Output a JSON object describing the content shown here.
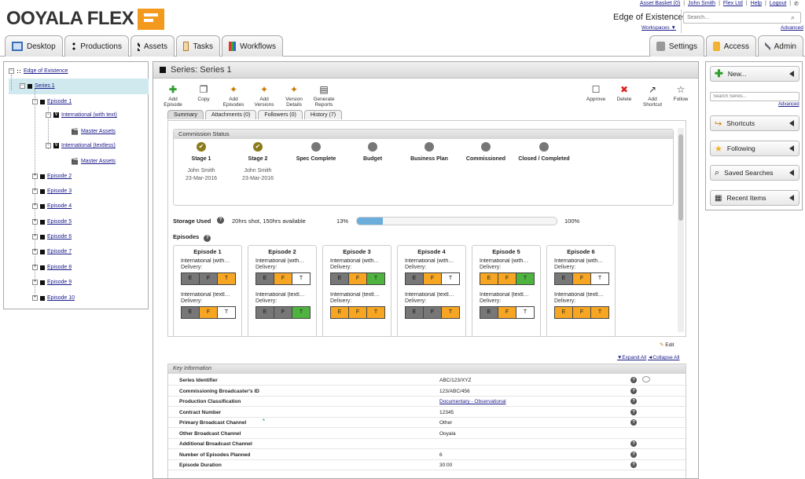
{
  "logo": "OOYALA FLEX",
  "toplinks": [
    "Asset Basket (0)",
    "John Smith",
    "Flex Ltd",
    "Help",
    "Logout"
  ],
  "workspace": {
    "title": "Edge of Existence",
    "link": "Workspaces ▼"
  },
  "search": {
    "placeholder": "Search...",
    "advanced": "Advanced"
  },
  "tabs": [
    "Desktop",
    "Productions",
    "Assets",
    "Tasks",
    "Workflows"
  ],
  "tabs_right": [
    "Settings",
    "Access",
    "Admin"
  ],
  "tree": {
    "root": "Edge of Existence",
    "series": "Series 1",
    "episode1": "Episode 1",
    "intl_text": "International (with text)",
    "master1": "Master Assets",
    "intl_textless": "International (textless)",
    "master2": "Master Assets",
    "episodes": [
      "Episode 2",
      "Episode 3",
      "Episode 4",
      "Episode 5",
      "Episode 6",
      "Episode 7",
      "Episode 8",
      "Episode 9",
      "Episode 10"
    ]
  },
  "main": {
    "title": "Series: Series 1",
    "toolbar": [
      "Add Episode",
      "Copy",
      "Add Episodes",
      "Add Versions",
      "Version Details",
      "Generate Reports"
    ],
    "toolbar_right": [
      "Approve",
      "Delete",
      "Add Shortcut",
      "Follow"
    ],
    "subtabs": [
      "Summary",
      "Attachments (0)",
      "Followers (0)",
      "History (7)"
    ]
  },
  "commission": {
    "header": "Commission Status",
    "stages": [
      {
        "name": "Stage 1",
        "done": true,
        "who": "John Smith",
        "date": "23-Mar-2016"
      },
      {
        "name": "Stage 2",
        "done": true,
        "who": "John Smith",
        "date": "23-Mar-2016"
      },
      {
        "name": "Spec Complete",
        "done": false
      },
      {
        "name": "Budget",
        "done": false
      },
      {
        "name": "Business Plan",
        "done": false
      },
      {
        "name": "Commissioned",
        "done": false
      },
      {
        "name": "Closed / Completed",
        "done": false
      }
    ]
  },
  "storage": {
    "label": "Storage Used",
    "text": "20hrs shot, 150hrs available",
    "percent_text": "13%",
    "fraction": 0.13,
    "max_text": "100%"
  },
  "episodes_label": "Episodes",
  "delivery_label": "Delivery:",
  "episodes": [
    {
      "title": "Episode 1",
      "v1": "International (with…",
      "c1": [
        "E",
        "F",
        "T"
      ],
      "s1": [
        "grey",
        "grey",
        "orange"
      ],
      "v2": "International (textl…",
      "c2": [
        "E",
        "F",
        "T"
      ],
      "s2": [
        "grey",
        "orange",
        "white"
      ]
    },
    {
      "title": "Episode 2",
      "v1": "International (with…",
      "c1": [
        "E",
        "F",
        "T"
      ],
      "s1": [
        "grey",
        "orange",
        "white"
      ],
      "v2": "International (textl…",
      "c2": [
        "E",
        "F",
        "T"
      ],
      "s2": [
        "grey",
        "grey",
        "green"
      ]
    },
    {
      "title": "Episode 3",
      "v1": "International (with…",
      "c1": [
        "E",
        "F",
        "T"
      ],
      "s1": [
        "grey",
        "orange",
        "green"
      ],
      "v2": "International (textl…",
      "c2": [
        "E",
        "F",
        "T"
      ],
      "s2": [
        "orange",
        "orange",
        "orange"
      ]
    },
    {
      "title": "Episode 4",
      "v1": "International (with…",
      "c1": [
        "E",
        "F",
        "T"
      ],
      "s1": [
        "grey",
        "orange",
        "white"
      ],
      "v2": "International (textl…",
      "c2": [
        "E",
        "F",
        "T"
      ],
      "s2": [
        "grey",
        "grey",
        "orange"
      ]
    },
    {
      "title": "Episode 5",
      "v1": "International (with…",
      "c1": [
        "E",
        "F",
        "T"
      ],
      "s1": [
        "orange",
        "orange",
        "green"
      ],
      "v2": "International (textl…",
      "c2": [
        "E",
        "F",
        "T"
      ],
      "s2": [
        "grey",
        "orange",
        "white"
      ]
    },
    {
      "title": "Episode 6",
      "v1": "International (with…",
      "c1": [
        "E",
        "F",
        "T"
      ],
      "s1": [
        "grey",
        "orange",
        "white"
      ],
      "v2": "International (textl…",
      "c2": [
        "E",
        "F",
        "T"
      ],
      "s2": [
        "orange",
        "orange",
        "orange"
      ]
    }
  ],
  "edit": "Edit",
  "expand_all": "▼Expand All",
  "collapse_all": "◄Collapse All",
  "key_info": {
    "header": "Key Information",
    "rows": [
      {
        "k": "Series Identifier",
        "v": "ABC/123/XYZ",
        "help": true
      },
      {
        "k": "Commissioning Broadcaster's ID",
        "v": "123/ABC/456",
        "help": true
      },
      {
        "k": "Production Classification",
        "v": "Documentary - Observational",
        "help": true
      },
      {
        "k": "Contract Number",
        "v": "12345",
        "help": true
      },
      {
        "k": "Primary Broadcast Channel",
        "v": "Other",
        "help": true
      },
      {
        "k": "Other Broadcast Channel",
        "v": "Ooyala",
        "help": false
      },
      {
        "k": "Additional Broadcast Channel",
        "v": "",
        "help": true
      },
      {
        "k": "Number of Episodes Planned",
        "v": "6",
        "help": true
      },
      {
        "k": "Episode Duration",
        "v": "30:00",
        "help": true
      }
    ]
  },
  "right": {
    "new": "New...",
    "search_placeholder": "Search Series...",
    "advanced": "Advanced",
    "items": [
      "Shortcuts",
      "Following",
      "Saved Searches",
      "Recent Items"
    ]
  },
  "colors": {
    "orange": "#f6a623",
    "green": "#4fb33f",
    "grey": "#777777",
    "accent": "#f39a1e"
  }
}
